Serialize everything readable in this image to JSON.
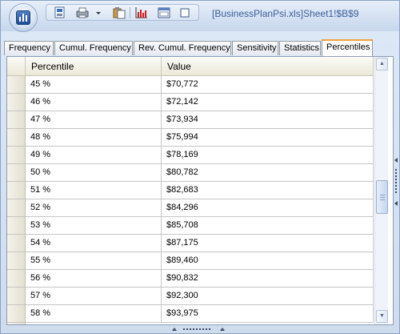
{
  "window": {
    "title": "[BusinessPlanPsi.xls]Sheet1!$B$9"
  },
  "tabs": [
    {
      "label": "Frequency",
      "active": false
    },
    {
      "label": "Cumul. Frequency",
      "active": false
    },
    {
      "label": "Rev. Cumul. Frequency",
      "active": false
    },
    {
      "label": "Sensitivity",
      "active": false
    },
    {
      "label": "Statistics",
      "active": false
    },
    {
      "label": "Percentiles",
      "active": true
    }
  ],
  "grid": {
    "columns": [
      "Percentile",
      "Value"
    ],
    "rows": [
      {
        "percentile": "45 %",
        "value": "$70,772"
      },
      {
        "percentile": "46 %",
        "value": "$72,142"
      },
      {
        "percentile": "47 %",
        "value": "$73,934"
      },
      {
        "percentile": "48 %",
        "value": "$75,994"
      },
      {
        "percentile": "49 %",
        "value": "$78,169"
      },
      {
        "percentile": "50 %",
        "value": "$80,782"
      },
      {
        "percentile": "51 %",
        "value": "$82,683"
      },
      {
        "percentile": "52 %",
        "value": "$84,296"
      },
      {
        "percentile": "53 %",
        "value": "$85,708"
      },
      {
        "percentile": "54 %",
        "value": "$87,175"
      },
      {
        "percentile": "55 %",
        "value": "$89,460"
      },
      {
        "percentile": "56 %",
        "value": "$90,832"
      },
      {
        "percentile": "57 %",
        "value": "$92,300"
      },
      {
        "percentile": "58 %",
        "value": "$93,975"
      }
    ]
  },
  "icons": {
    "app": "chart-app-icon",
    "toolbar": [
      "export-icon",
      "print-icon",
      "dropdown-arrow-icon",
      "clipboard-icon",
      "chart-icon",
      "window-icon",
      "maximize-icon"
    ]
  },
  "colors": {
    "accent_tab": "#f0a040",
    "title_text": "#3b5f99"
  }
}
